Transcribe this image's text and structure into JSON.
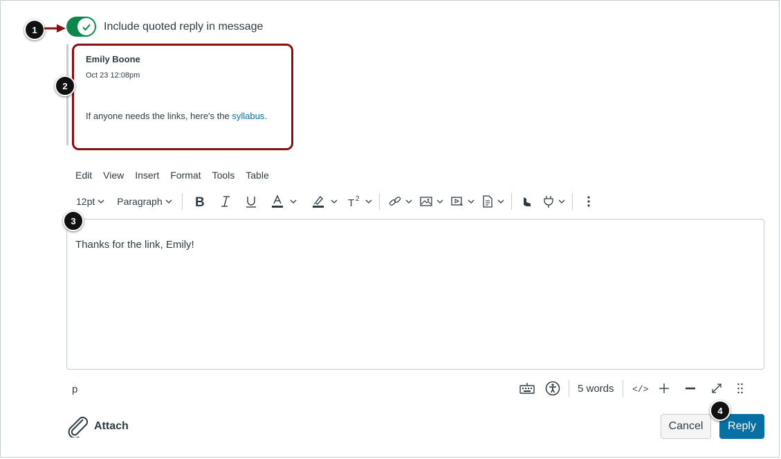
{
  "toggle": {
    "label": "Include quoted reply in message",
    "on": true,
    "color": "#0b874b"
  },
  "quote": {
    "author": "Emily Boone",
    "date": "Oct 23 12:08pm",
    "text_before": "If anyone needs the links, here's the ",
    "link_text": "syllabus",
    "text_after": "."
  },
  "menubar": [
    "Edit",
    "View",
    "Insert",
    "Format",
    "Tools",
    "Table"
  ],
  "toolbar": {
    "font_size": "12pt",
    "block_format": "Paragraph"
  },
  "editor": {
    "content": "Thanks for the link, Emily!"
  },
  "status": {
    "path": "p",
    "word_count": "5 words"
  },
  "actions": {
    "attach_label": "Attach",
    "cancel_label": "Cancel",
    "reply_label": "Reply"
  },
  "badges": [
    "1",
    "2",
    "3",
    "4"
  ],
  "colors": {
    "accent": "#0770a3",
    "highlight_border": "#8b0e0e",
    "badge": "#111111"
  },
  "icons": [
    "check-icon",
    "bold-icon",
    "italic-icon",
    "underline-icon",
    "text-color-icon",
    "highlight-icon",
    "superscript-icon",
    "link-icon",
    "image-icon",
    "media-icon",
    "document-icon",
    "lti-apps-icon",
    "plug-icon",
    "more-icon",
    "keyboard-icon",
    "accessibility-icon",
    "html-editor-icon",
    "zoom-in-icon",
    "zoom-out-icon",
    "fullscreen-icon",
    "drag-handle-icon",
    "paperclip-icon"
  ]
}
